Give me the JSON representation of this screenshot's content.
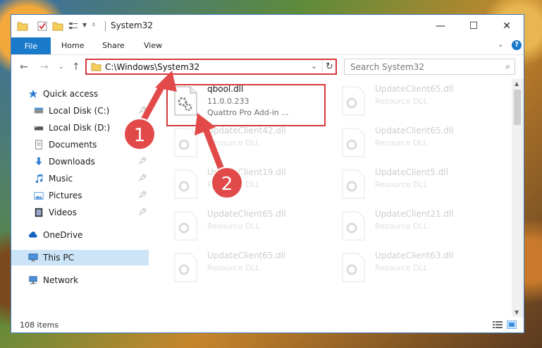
{
  "window": {
    "title": "System32"
  },
  "ribbon": {
    "file": "File",
    "home": "Home",
    "share": "Share",
    "view": "View",
    "help": "?"
  },
  "address": {
    "path": "C:\\Windows\\System32"
  },
  "search": {
    "placeholder": "Search System32"
  },
  "sidebar": {
    "items": [
      {
        "label": "Quick access",
        "icon": "star-icon",
        "pinned": false
      },
      {
        "label": "Local Disk (C:)",
        "icon": "disk-icon",
        "pinned": true
      },
      {
        "label": "Local Disk (D:)",
        "icon": "disk-icon",
        "pinned": true
      },
      {
        "label": "Documents",
        "icon": "documents-icon",
        "pinned": true
      },
      {
        "label": "Downloads",
        "icon": "downloads-icon",
        "pinned": true
      },
      {
        "label": "Music",
        "icon": "music-icon",
        "pinned": true
      },
      {
        "label": "Pictures",
        "icon": "pictures-icon",
        "pinned": true
      },
      {
        "label": "Videos",
        "icon": "videos-icon",
        "pinned": true
      },
      {
        "label": "OneDrive",
        "icon": "cloud-icon",
        "pinned": false
      },
      {
        "label": "This PC",
        "icon": "computer-icon",
        "pinned": false,
        "selected": true
      },
      {
        "label": "Network",
        "icon": "network-icon",
        "pinned": false
      }
    ]
  },
  "files": [
    {
      "name": "qbool.dll",
      "version": "11.0.0.233",
      "description": "Quattro Pro Add-in ..."
    },
    {
      "name": "UpdateClient65.dll",
      "version": "Resource DLL",
      "description": ""
    },
    {
      "name": "UpdateClient42.dll",
      "version": "Resource DLL",
      "description": ""
    },
    {
      "name": "UpdateClient65.dll",
      "version": "Resource DLL",
      "description": ""
    },
    {
      "name": "UpdateClient19.dll",
      "version": "Resource DLL",
      "description": ""
    },
    {
      "name": "UpdateClient5.dll",
      "version": "Resource DLL",
      "description": ""
    },
    {
      "name": "UpdateClient65.dll",
      "version": "Resource DLL",
      "description": ""
    },
    {
      "name": "UpdateClient21.dll",
      "version": "Resource DLL",
      "description": ""
    },
    {
      "name": "UpdateClient65.dll",
      "version": "Resource DLL",
      "description": ""
    },
    {
      "name": "UpdateClient63.dll",
      "version": "Resource DLL",
      "description": ""
    }
  ],
  "status": {
    "items": "108 items"
  },
  "annotations": {
    "one": "1",
    "two": "2"
  },
  "colors": {
    "accent": "#1979ca",
    "highlight": "#d6383a",
    "selected": "#cce4f7"
  }
}
